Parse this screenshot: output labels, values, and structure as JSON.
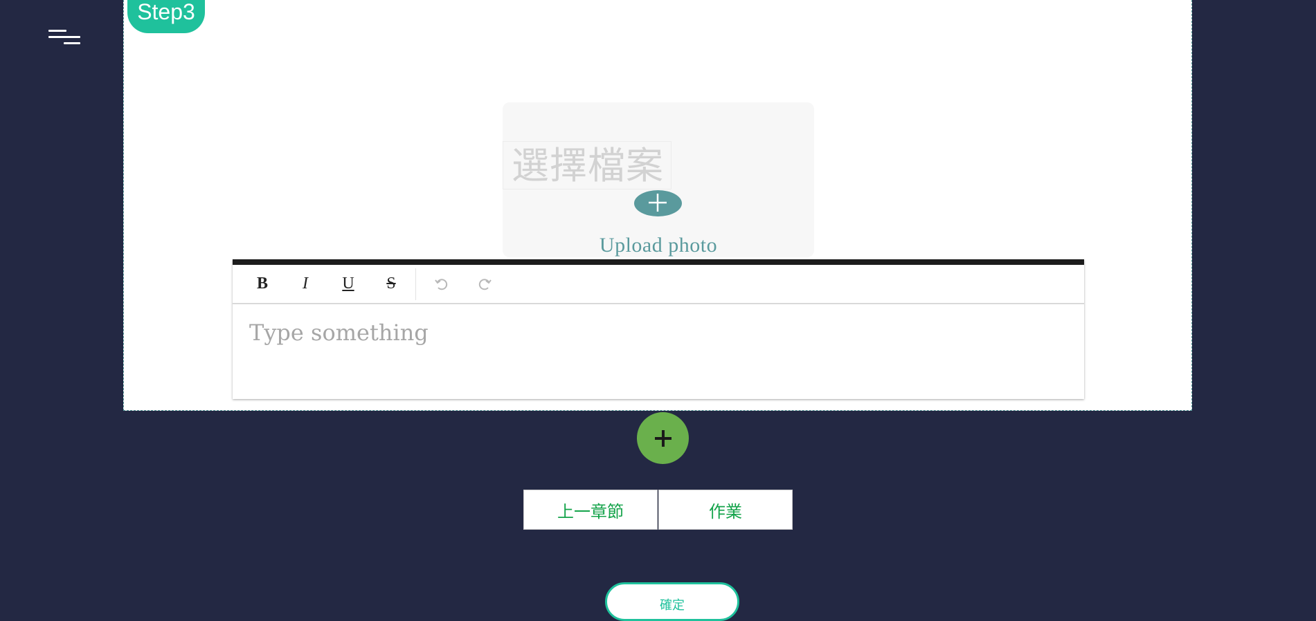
{
  "step": {
    "badge": "Step3"
  },
  "upload": {
    "choose_file_label": "選擇檔案",
    "upload_label": "Upload photo"
  },
  "editor": {
    "toolbar": {
      "bold": "B",
      "italic": "I",
      "underline": "U",
      "strike": "S"
    },
    "placeholder": "Type something"
  },
  "navigation": {
    "prev_label": "上一章節",
    "homework_label": "作業"
  },
  "confirm": {
    "label": "確定"
  },
  "colors": {
    "background": "#232843",
    "accent_teal": "#1fc19c",
    "upload_teal": "#5a9a9d",
    "add_green": "#6ab04c",
    "nav_text_green": "#14a34a"
  }
}
